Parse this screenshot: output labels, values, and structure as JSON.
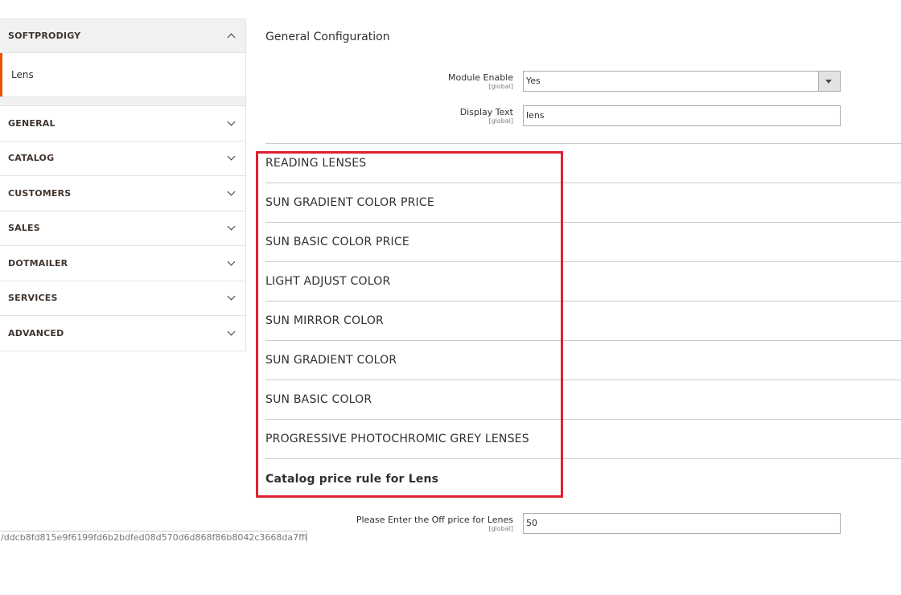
{
  "sidebar": {
    "section_title": "SOFTPRODIGY",
    "sub_item": "Lens",
    "items": [
      "GENERAL",
      "CATALOG",
      "CUSTOMERS",
      "SALES",
      "DOTMAILER",
      "SERVICES",
      "ADVANCED"
    ]
  },
  "hash_text": "/ddcb8fd815e9f6199fd6b2bdfed08d570d6d868f86b8042c3668da7ffb",
  "main": {
    "title": "General Configuration",
    "module_enable": {
      "label": "Module Enable",
      "scope": "[global]",
      "value": "Yes"
    },
    "display_text": {
      "label": "Display Text",
      "scope": "[global]",
      "value": "lens"
    },
    "groups": [
      "READING LENSES",
      "SUN GRADIENT COLOR PRICE",
      "SUN BASIC COLOR PRICE",
      "LIGHT ADJUST COLOR",
      "SUN MIRROR COLOR",
      "SUN GRADIENT COLOR",
      "SUN BASIC COLOR",
      "PROGRESSIVE PHOTOCHROMIC GREY LENSES",
      "Catalog price rule for Lens"
    ],
    "off_price": {
      "label": "Please Enter the Off price for Lenes",
      "scope": "[global]",
      "value": "50"
    }
  },
  "colors": {
    "accent": "#eb5202",
    "highlight": "#e02030"
  }
}
